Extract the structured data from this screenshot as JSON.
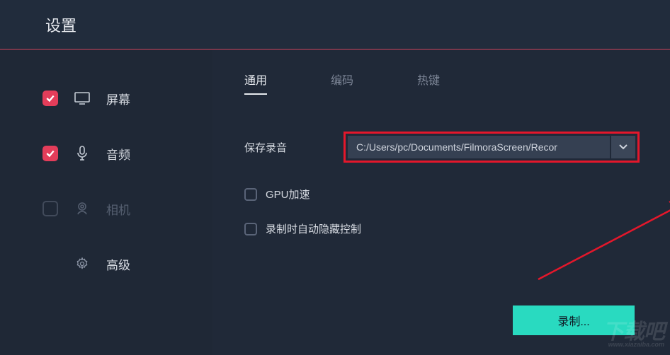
{
  "header": {
    "title": "设置"
  },
  "sidebar": {
    "items": [
      {
        "label": "屏幕",
        "checked": true
      },
      {
        "label": "音频",
        "checked": true
      },
      {
        "label": "相机",
        "checked": false
      },
      {
        "label": "高级"
      }
    ]
  },
  "tabs": [
    {
      "label": "通用",
      "active": true
    },
    {
      "label": "编码",
      "active": false
    },
    {
      "label": "热键",
      "active": false
    }
  ],
  "settings": {
    "save_label": "保存录音",
    "save_path": "C:/Users/pc/Documents/FilmoraScreen/Recor",
    "gpu_label": "GPU加速",
    "hide_label": "录制时自动隐藏控制"
  },
  "buttons": {
    "record": "录制..."
  },
  "watermark": {
    "main": "下载吧",
    "sub": "www.xiazaiba.com"
  }
}
